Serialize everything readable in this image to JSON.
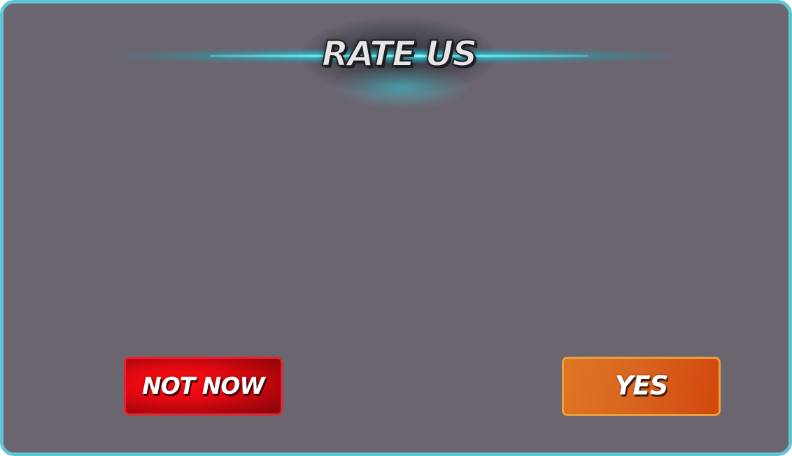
{
  "dialog": {
    "title": "RATE US",
    "colors": {
      "border": "#5ec6d4",
      "background": "#6b6570",
      "title_glow": "#3cd2dc"
    }
  },
  "buttons": {
    "not_now_label": "NOT NOW",
    "yes_label": "YES",
    "not_now_color": "#e00810",
    "yes_color": "#d96520"
  }
}
